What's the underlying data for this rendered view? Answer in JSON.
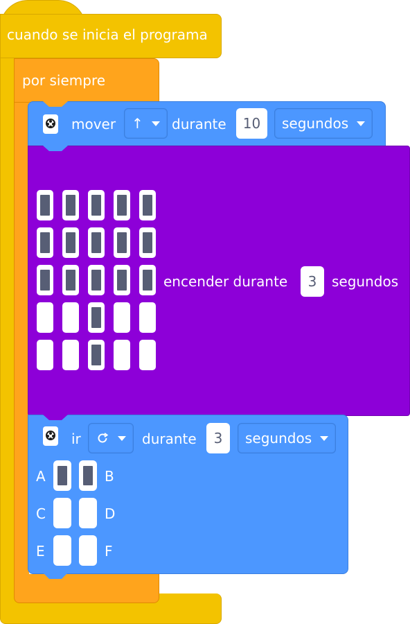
{
  "hat": {
    "label": "cuando se inicia el programa",
    "color": "#f3c300"
  },
  "forever": {
    "label": "por siempre",
    "color": "#ffa41c"
  },
  "move": {
    "label": "mover",
    "direction": "↑",
    "during_label": "durante",
    "duration": "10",
    "unit": "segundos",
    "icon": "robot-controller-icon",
    "color": "#4c97ff"
  },
  "light": {
    "label": "encender durante",
    "duration": "3",
    "unit": "segundos",
    "color": "#8d00d8",
    "matrix": [
      [
        1,
        1,
        1,
        1,
        1
      ],
      [
        1,
        1,
        1,
        1,
        1
      ],
      [
        1,
        1,
        1,
        1,
        1
      ],
      [
        0,
        0,
        1,
        0,
        0
      ],
      [
        0,
        0,
        1,
        0,
        0
      ]
    ]
  },
  "go": {
    "label": "ir",
    "direction_icon": "rotate-clockwise-icon",
    "during_label": "durante",
    "duration": "3",
    "unit": "segundos",
    "icon": "robot-controller-icon",
    "color": "#4c97ff",
    "motors": [
      {
        "left": "A",
        "right": "B",
        "left_on": true,
        "right_on": true
      },
      {
        "left": "C",
        "right": "D",
        "left_on": false,
        "right_on": false
      },
      {
        "left": "E",
        "right": "F",
        "left_on": false,
        "right_on": false
      }
    ]
  }
}
